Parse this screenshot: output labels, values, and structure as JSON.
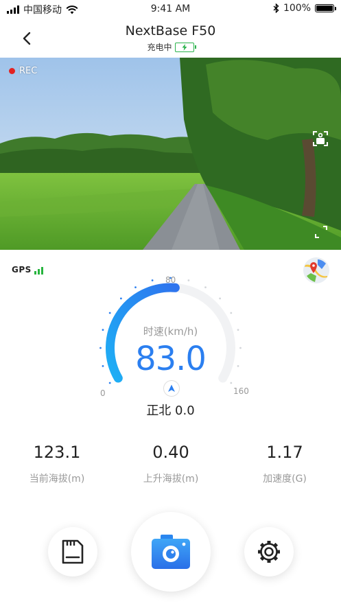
{
  "status_bar": {
    "carrier": "中国移动",
    "time": "9:41 AM",
    "battery_percent": "100%"
  },
  "header": {
    "title": "NextBase F50",
    "charging_status": "充电中",
    "back_icon": "chevron-left-icon"
  },
  "camera": {
    "rec_label": "REC",
    "rec_color": "#e32222",
    "switch_icon": "camera-switch-icon",
    "fullscreen_icon": "fullscreen-icon"
  },
  "gps": {
    "label": "GPS",
    "signal_bars": 3,
    "signal_color": "#27b43e"
  },
  "gauge": {
    "min_label": "0",
    "mid_label": "80",
    "max_label": "160",
    "speed_label": "时速(km/h)",
    "speed_value": "83.0",
    "speed_max": 160,
    "accent_color": "#2b7ff0",
    "heading": "正北 0.0"
  },
  "stats": [
    {
      "value": "123.1",
      "label": "当前海拔(m)"
    },
    {
      "value": "0.40",
      "label": "上升海拔(m)"
    },
    {
      "value": "1.17",
      "label": "加速度(G)"
    }
  ],
  "actions": {
    "storage_icon": "sd-card-icon",
    "capture_icon": "camera-icon",
    "settings_icon": "gear-icon"
  }
}
